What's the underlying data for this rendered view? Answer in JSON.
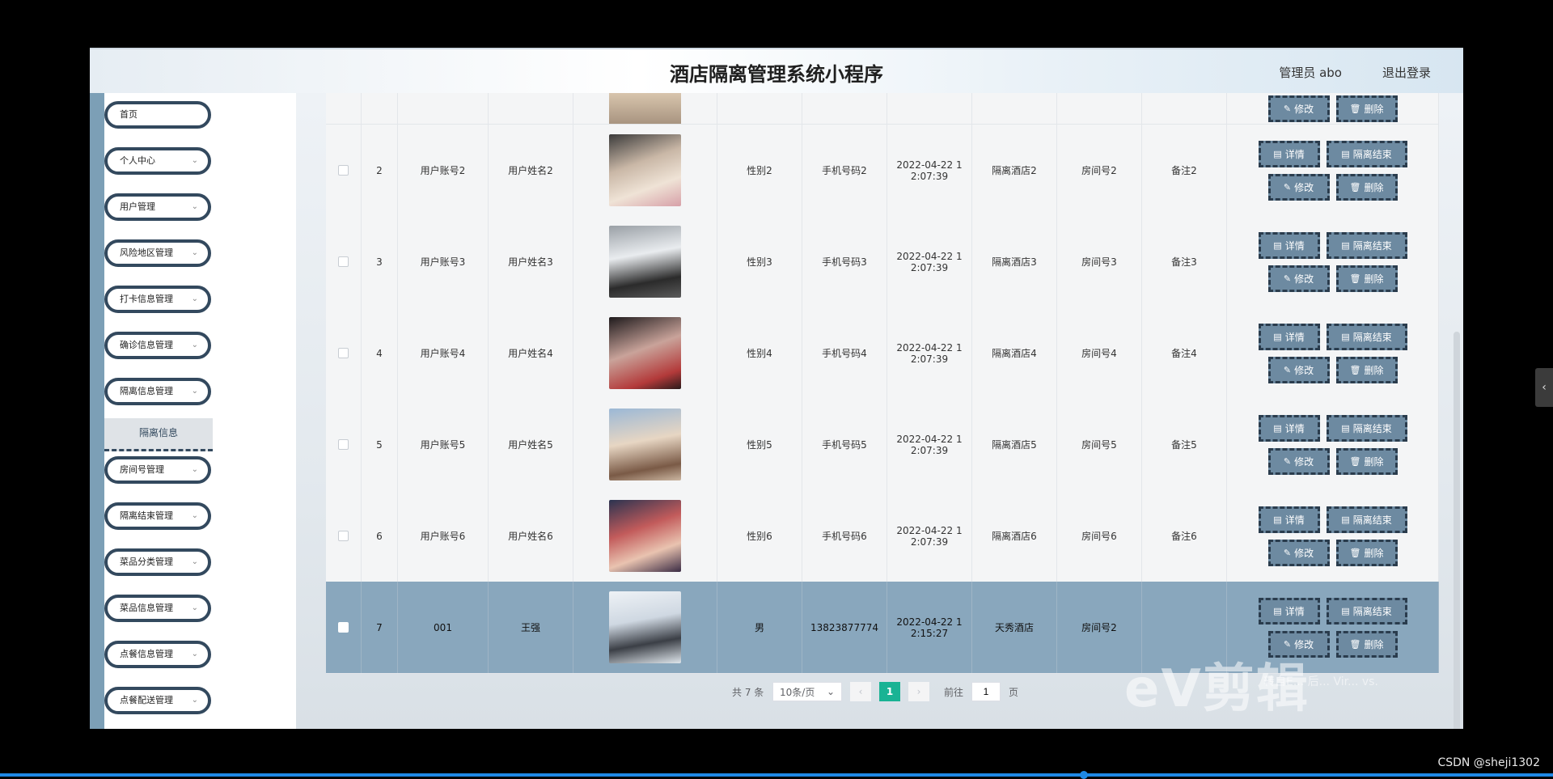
{
  "header": {
    "title": "酒店隔离管理系统小程序",
    "user": "管理员 abo",
    "logout": "退出登录"
  },
  "sidebar": {
    "items": [
      {
        "label": "首页",
        "expand": false
      },
      {
        "label": "个人中心",
        "expand": true
      },
      {
        "label": "用户管理",
        "expand": true
      },
      {
        "label": "风险地区管理",
        "expand": true
      },
      {
        "label": "打卡信息管理",
        "expand": true
      },
      {
        "label": "确诊信息管理",
        "expand": true
      },
      {
        "label": "隔离信息管理",
        "expand": true
      },
      {
        "label": "房间号管理",
        "expand": true
      },
      {
        "label": "隔离结束管理",
        "expand": true
      },
      {
        "label": "菜品分类管理",
        "expand": true
      },
      {
        "label": "菜品信息管理",
        "expand": true
      },
      {
        "label": "点餐信息管理",
        "expand": true
      },
      {
        "label": "点餐配送管理",
        "expand": true
      }
    ],
    "submenu_label": "隔离信息"
  },
  "table": {
    "buttons": {
      "detail": "详情",
      "end": "隔离结束",
      "edit": "修改",
      "delete": "删除"
    },
    "rows": [
      {
        "index": "2",
        "account": "用户账号2",
        "name": "用户姓名2",
        "gender": "性别2",
        "phone": "手机号码2",
        "time": "2022-04-22 1\n2:07:39",
        "hotel": "隔离酒店2",
        "room": "房间号2",
        "note": "备注2",
        "photo": "photo-1",
        "selected": false
      },
      {
        "index": "3",
        "account": "用户账号3",
        "name": "用户姓名3",
        "gender": "性别3",
        "phone": "手机号码3",
        "time": "2022-04-22 1\n2:07:39",
        "hotel": "隔离酒店3",
        "room": "房间号3",
        "note": "备注3",
        "photo": "photo-2",
        "selected": false
      },
      {
        "index": "4",
        "account": "用户账号4",
        "name": "用户姓名4",
        "gender": "性别4",
        "phone": "手机号码4",
        "time": "2022-04-22 1\n2:07:39",
        "hotel": "隔离酒店4",
        "room": "房间号4",
        "note": "备注4",
        "photo": "photo-3",
        "selected": false
      },
      {
        "index": "5",
        "account": "用户账号5",
        "name": "用户姓名5",
        "gender": "性别5",
        "phone": "手机号码5",
        "time": "2022-04-22 1\n2:07:39",
        "hotel": "隔离酒店5",
        "room": "房间号5",
        "note": "备注5",
        "photo": "photo-4",
        "selected": false
      },
      {
        "index": "6",
        "account": "用户账号6",
        "name": "用户姓名6",
        "gender": "性别6",
        "phone": "手机号码6",
        "time": "2022-04-22 1\n2:07:39",
        "hotel": "隔离酒店6",
        "room": "房间号6",
        "note": "备注6",
        "photo": "photo-5",
        "selected": false
      },
      {
        "index": "7",
        "account": "001",
        "name": "王强",
        "gender": "男",
        "phone": "13823877774",
        "time": "2022-04-22 1\n2:15:27",
        "hotel": "天秀酒店",
        "room": "房间号2",
        "note": "",
        "photo": "photo-6",
        "selected": true
      }
    ]
  },
  "pagination": {
    "total": "共 7 条",
    "page_size": "10条/页",
    "current": "1",
    "goto_prefix": "前往",
    "goto_value": "1",
    "goto_suffix": "页"
  },
  "overlay": {
    "watermark": "eV剪辑",
    "watermark_sub": "转自E... 后... Vir... vs.",
    "credit": "CSDN @sheji1302",
    "progress": 0.698
  },
  "colors": {
    "accent": "#19b394",
    "button": "#6d8aa1",
    "selected_row": "#89a7bd",
    "sidebar_border": "#33495e"
  }
}
